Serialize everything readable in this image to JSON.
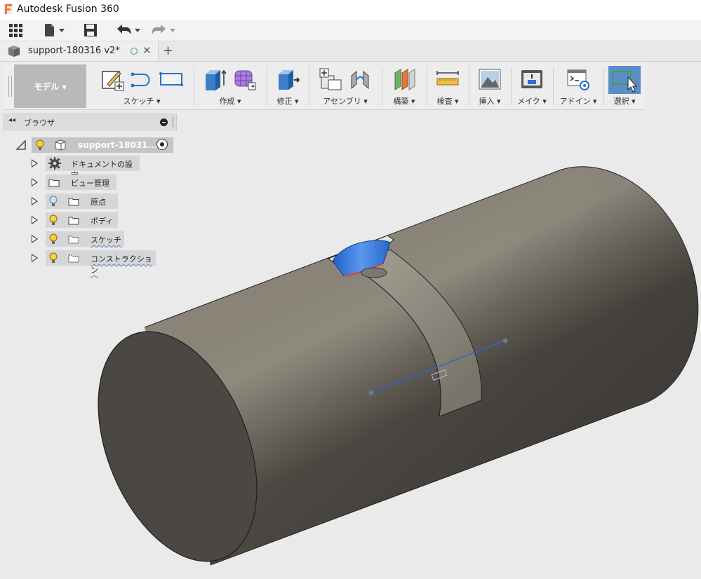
{
  "app": {
    "title": "Autodesk Fusion 360"
  },
  "document_tab": {
    "label": "support-180316 v2*"
  },
  "workspace": {
    "label": "モデル ▾"
  },
  "ribbon": {
    "groups": [
      {
        "label": "スケッチ ▾"
      },
      {
        "label": "作成 ▾"
      },
      {
        "label": "修正 ▾"
      },
      {
        "label": "アセンブリ ▾"
      },
      {
        "label": "構築 ▾"
      },
      {
        "label": "検査 ▾"
      },
      {
        "label": "挿入 ▾"
      },
      {
        "label": "メイク ▾"
      },
      {
        "label": "アドイン ▾"
      },
      {
        "label": "選択 ▾"
      }
    ]
  },
  "browser": {
    "title": "ブラウザ",
    "root": {
      "label": "support-18031..."
    },
    "items": [
      {
        "label": "ドキュメントの設定"
      },
      {
        "label": "ビュー管理"
      },
      {
        "label": "原点"
      },
      {
        "label": "ボディ"
      },
      {
        "label": "スケッチ"
      },
      {
        "label": "コンストラクション"
      }
    ]
  },
  "colors": {
    "body_light": "#8e887b",
    "body_dark": "#5a5650",
    "end_face": "#4a4743",
    "accent_blue": "#3f7fd8",
    "selection_blue": "#5b8ec9"
  }
}
